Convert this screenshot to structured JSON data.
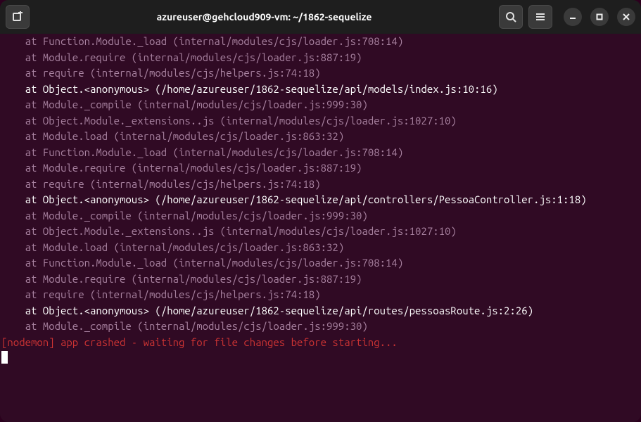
{
  "titlebar": {
    "title": "azureuser@gehcloud909-vm: ~/1862-sequelize"
  },
  "terminal": {
    "lines": [
      {
        "style": "dim",
        "text": "    at Function.Module._load (internal/modules/cjs/loader.js:708:14)"
      },
      {
        "style": "dim",
        "text": "    at Module.require (internal/modules/cjs/loader.js:887:19)"
      },
      {
        "style": "dim",
        "text": "    at require (internal/modules/cjs/helpers.js:74:18)"
      },
      {
        "style": "bright",
        "text": "    at Object.<anonymous> (/home/azureuser/1862-sequelize/api/models/index.js:10:16)"
      },
      {
        "style": "dim",
        "text": "    at Module._compile (internal/modules/cjs/loader.js:999:30)"
      },
      {
        "style": "dim",
        "text": "    at Object.Module._extensions..js (internal/modules/cjs/loader.js:1027:10)"
      },
      {
        "style": "dim",
        "text": "    at Module.load (internal/modules/cjs/loader.js:863:32)"
      },
      {
        "style": "dim",
        "text": "    at Function.Module._load (internal/modules/cjs/loader.js:708:14)"
      },
      {
        "style": "dim",
        "text": "    at Module.require (internal/modules/cjs/loader.js:887:19)"
      },
      {
        "style": "dim",
        "text": "    at require (internal/modules/cjs/helpers.js:74:18)"
      },
      {
        "style": "bright",
        "text": "    at Object.<anonymous> (/home/azureuser/1862-sequelize/api/controllers/PessoaController.js:1:18)"
      },
      {
        "style": "dim",
        "text": "    at Module._compile (internal/modules/cjs/loader.js:999:30)"
      },
      {
        "style": "dim",
        "text": "    at Object.Module._extensions..js (internal/modules/cjs/loader.js:1027:10)"
      },
      {
        "style": "dim",
        "text": "    at Module.load (internal/modules/cjs/loader.js:863:32)"
      },
      {
        "style": "dim",
        "text": "    at Function.Module._load (internal/modules/cjs/loader.js:708:14)"
      },
      {
        "style": "dim",
        "text": "    at Module.require (internal/modules/cjs/loader.js:887:19)"
      },
      {
        "style": "dim",
        "text": "    at require (internal/modules/cjs/helpers.js:74:18)"
      },
      {
        "style": "bright",
        "text": "    at Object.<anonymous> (/home/azureuser/1862-sequelize/api/routes/pessoasRoute.js:2:26)"
      },
      {
        "style": "dim",
        "text": "    at Module._compile (internal/modules/cjs/loader.js:999:30)"
      },
      {
        "style": "crash",
        "text": "[nodemon] app crashed - waiting for file changes before starting..."
      }
    ]
  }
}
